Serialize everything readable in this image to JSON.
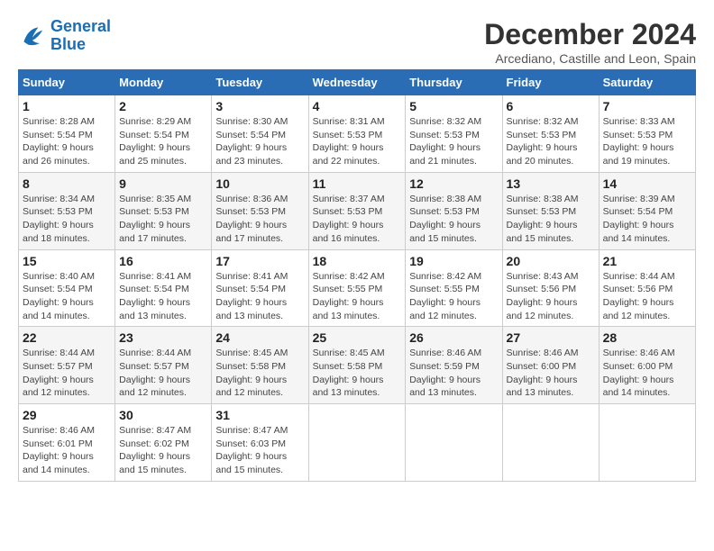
{
  "logo": {
    "line1": "General",
    "line2": "Blue"
  },
  "title": "December 2024",
  "subtitle": "Arcediano, Castille and Leon, Spain",
  "days_header": [
    "Sunday",
    "Monday",
    "Tuesday",
    "Wednesday",
    "Thursday",
    "Friday",
    "Saturday"
  ],
  "weeks": [
    [
      {
        "day": "1",
        "info": "Sunrise: 8:28 AM\nSunset: 5:54 PM\nDaylight: 9 hours\nand 26 minutes."
      },
      {
        "day": "2",
        "info": "Sunrise: 8:29 AM\nSunset: 5:54 PM\nDaylight: 9 hours\nand 25 minutes."
      },
      {
        "day": "3",
        "info": "Sunrise: 8:30 AM\nSunset: 5:54 PM\nDaylight: 9 hours\nand 23 minutes."
      },
      {
        "day": "4",
        "info": "Sunrise: 8:31 AM\nSunset: 5:53 PM\nDaylight: 9 hours\nand 22 minutes."
      },
      {
        "day": "5",
        "info": "Sunrise: 8:32 AM\nSunset: 5:53 PM\nDaylight: 9 hours\nand 21 minutes."
      },
      {
        "day": "6",
        "info": "Sunrise: 8:32 AM\nSunset: 5:53 PM\nDaylight: 9 hours\nand 20 minutes."
      },
      {
        "day": "7",
        "info": "Sunrise: 8:33 AM\nSunset: 5:53 PM\nDaylight: 9 hours\nand 19 minutes."
      }
    ],
    [
      {
        "day": "8",
        "info": "Sunrise: 8:34 AM\nSunset: 5:53 PM\nDaylight: 9 hours\nand 18 minutes."
      },
      {
        "day": "9",
        "info": "Sunrise: 8:35 AM\nSunset: 5:53 PM\nDaylight: 9 hours\nand 17 minutes."
      },
      {
        "day": "10",
        "info": "Sunrise: 8:36 AM\nSunset: 5:53 PM\nDaylight: 9 hours\nand 17 minutes."
      },
      {
        "day": "11",
        "info": "Sunrise: 8:37 AM\nSunset: 5:53 PM\nDaylight: 9 hours\nand 16 minutes."
      },
      {
        "day": "12",
        "info": "Sunrise: 8:38 AM\nSunset: 5:53 PM\nDaylight: 9 hours\nand 15 minutes."
      },
      {
        "day": "13",
        "info": "Sunrise: 8:38 AM\nSunset: 5:53 PM\nDaylight: 9 hours\nand 15 minutes."
      },
      {
        "day": "14",
        "info": "Sunrise: 8:39 AM\nSunset: 5:54 PM\nDaylight: 9 hours\nand 14 minutes."
      }
    ],
    [
      {
        "day": "15",
        "info": "Sunrise: 8:40 AM\nSunset: 5:54 PM\nDaylight: 9 hours\nand 14 minutes."
      },
      {
        "day": "16",
        "info": "Sunrise: 8:41 AM\nSunset: 5:54 PM\nDaylight: 9 hours\nand 13 minutes."
      },
      {
        "day": "17",
        "info": "Sunrise: 8:41 AM\nSunset: 5:54 PM\nDaylight: 9 hours\nand 13 minutes."
      },
      {
        "day": "18",
        "info": "Sunrise: 8:42 AM\nSunset: 5:55 PM\nDaylight: 9 hours\nand 13 minutes."
      },
      {
        "day": "19",
        "info": "Sunrise: 8:42 AM\nSunset: 5:55 PM\nDaylight: 9 hours\nand 12 minutes."
      },
      {
        "day": "20",
        "info": "Sunrise: 8:43 AM\nSunset: 5:56 PM\nDaylight: 9 hours\nand 12 minutes."
      },
      {
        "day": "21",
        "info": "Sunrise: 8:44 AM\nSunset: 5:56 PM\nDaylight: 9 hours\nand 12 minutes."
      }
    ],
    [
      {
        "day": "22",
        "info": "Sunrise: 8:44 AM\nSunset: 5:57 PM\nDaylight: 9 hours\nand 12 minutes."
      },
      {
        "day": "23",
        "info": "Sunrise: 8:44 AM\nSunset: 5:57 PM\nDaylight: 9 hours\nand 12 minutes."
      },
      {
        "day": "24",
        "info": "Sunrise: 8:45 AM\nSunset: 5:58 PM\nDaylight: 9 hours\nand 12 minutes."
      },
      {
        "day": "25",
        "info": "Sunrise: 8:45 AM\nSunset: 5:58 PM\nDaylight: 9 hours\nand 13 minutes."
      },
      {
        "day": "26",
        "info": "Sunrise: 8:46 AM\nSunset: 5:59 PM\nDaylight: 9 hours\nand 13 minutes."
      },
      {
        "day": "27",
        "info": "Sunrise: 8:46 AM\nSunset: 6:00 PM\nDaylight: 9 hours\nand 13 minutes."
      },
      {
        "day": "28",
        "info": "Sunrise: 8:46 AM\nSunset: 6:00 PM\nDaylight: 9 hours\nand 14 minutes."
      }
    ],
    [
      {
        "day": "29",
        "info": "Sunrise: 8:46 AM\nSunset: 6:01 PM\nDaylight: 9 hours\nand 14 minutes."
      },
      {
        "day": "30",
        "info": "Sunrise: 8:47 AM\nSunset: 6:02 PM\nDaylight: 9 hours\nand 15 minutes."
      },
      {
        "day": "31",
        "info": "Sunrise: 8:47 AM\nSunset: 6:03 PM\nDaylight: 9 hours\nand 15 minutes."
      },
      null,
      null,
      null,
      null
    ]
  ]
}
